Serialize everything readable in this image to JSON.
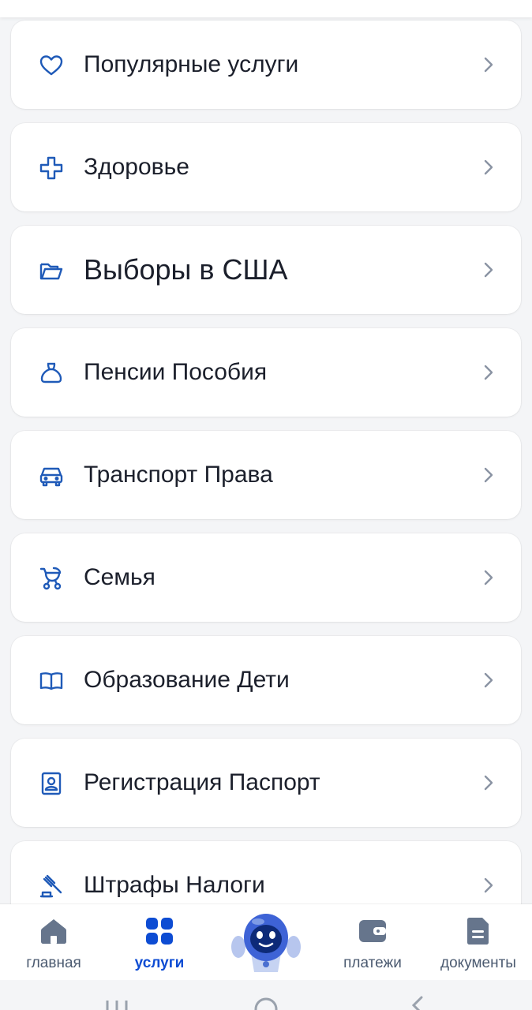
{
  "categories": [
    {
      "label": "Популярные услуги",
      "icon": "heart-icon"
    },
    {
      "label": "Здоровье",
      "icon": "medical-cross-icon"
    },
    {
      "label": "Выборы в США",
      "icon": "folder-icon"
    },
    {
      "label": "Пенсии Пособия",
      "icon": "bag-icon"
    },
    {
      "label": "Транспорт Права",
      "icon": "car-icon"
    },
    {
      "label": "Семья",
      "icon": "baby-stroller-icon"
    },
    {
      "label": "Образование Дети",
      "icon": "book-icon"
    },
    {
      "label": "Регистрация Паспорт",
      "icon": "passport-icon"
    },
    {
      "label": "Штрафы Налоги",
      "icon": "gavel-icon"
    }
  ],
  "nav": {
    "home": "главная",
    "services": "услуги",
    "assistant": "robot-assistant-icon",
    "payments": "платежи",
    "documents": "документы",
    "active": "services"
  },
  "colors": {
    "accent": "#0d4cd3",
    "icon": "#1f5ab8",
    "nav_icon": "#66758c",
    "text": "#1b1f2b",
    "chevron": "#8a93a3",
    "background": "#f4f5f7"
  }
}
